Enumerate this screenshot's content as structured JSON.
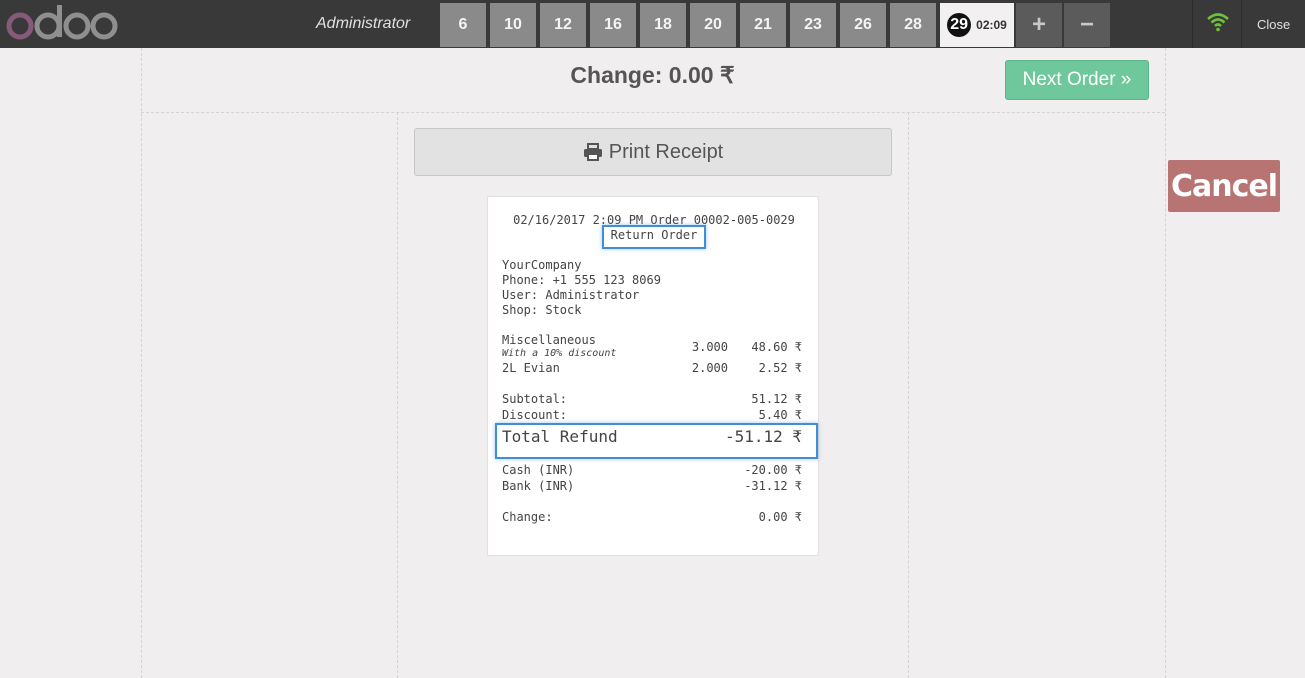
{
  "header": {
    "brand": "odoo",
    "user": "Administrator",
    "orders": [
      "6",
      "10",
      "12",
      "16",
      "18",
      "20",
      "21",
      "23",
      "26",
      "28"
    ],
    "selected_order": {
      "number": "29",
      "time": "02:09"
    },
    "add_label": "+",
    "remove_label": "−",
    "close_label": "Close",
    "wifi_color": "#6fc13b"
  },
  "screen": {
    "change_title": "Change: 0.00 ₹",
    "next_order_label": "Next Order »",
    "print_receipt_label": "Print Receipt",
    "cancel_label": "Cancel"
  },
  "receipt": {
    "datetime_order": "02/16/2017 2:09 PM Order 00002-005-0029",
    "return_label": "Return Order",
    "company": "YourCompany",
    "phone": "Phone: +1 555 123 8069",
    "user": "User: Administrator",
    "shop": "Shop: Stock",
    "lines": [
      {
        "name": "Miscellaneous",
        "note": "With a 10% discount",
        "qty": "3.000",
        "price": "48.60 ₹"
      },
      {
        "name": "2L Evian",
        "note": "",
        "qty": "2.000",
        "price": "2.52 ₹"
      }
    ],
    "subtotal_label": "Subtotal:",
    "subtotal_value": "51.12 ₹",
    "discount_label": "Discount:",
    "discount_value": "5.40 ₹",
    "total_label": "Total Refund",
    "total_value": "-51.12 ₹",
    "payments": [
      {
        "label": "Cash (INR)",
        "value": "-20.00 ₹"
      },
      {
        "label": "Bank (INR)",
        "value": "-31.12 ₹"
      }
    ],
    "change_label": "Change:",
    "change_value": "0.00 ₹"
  }
}
